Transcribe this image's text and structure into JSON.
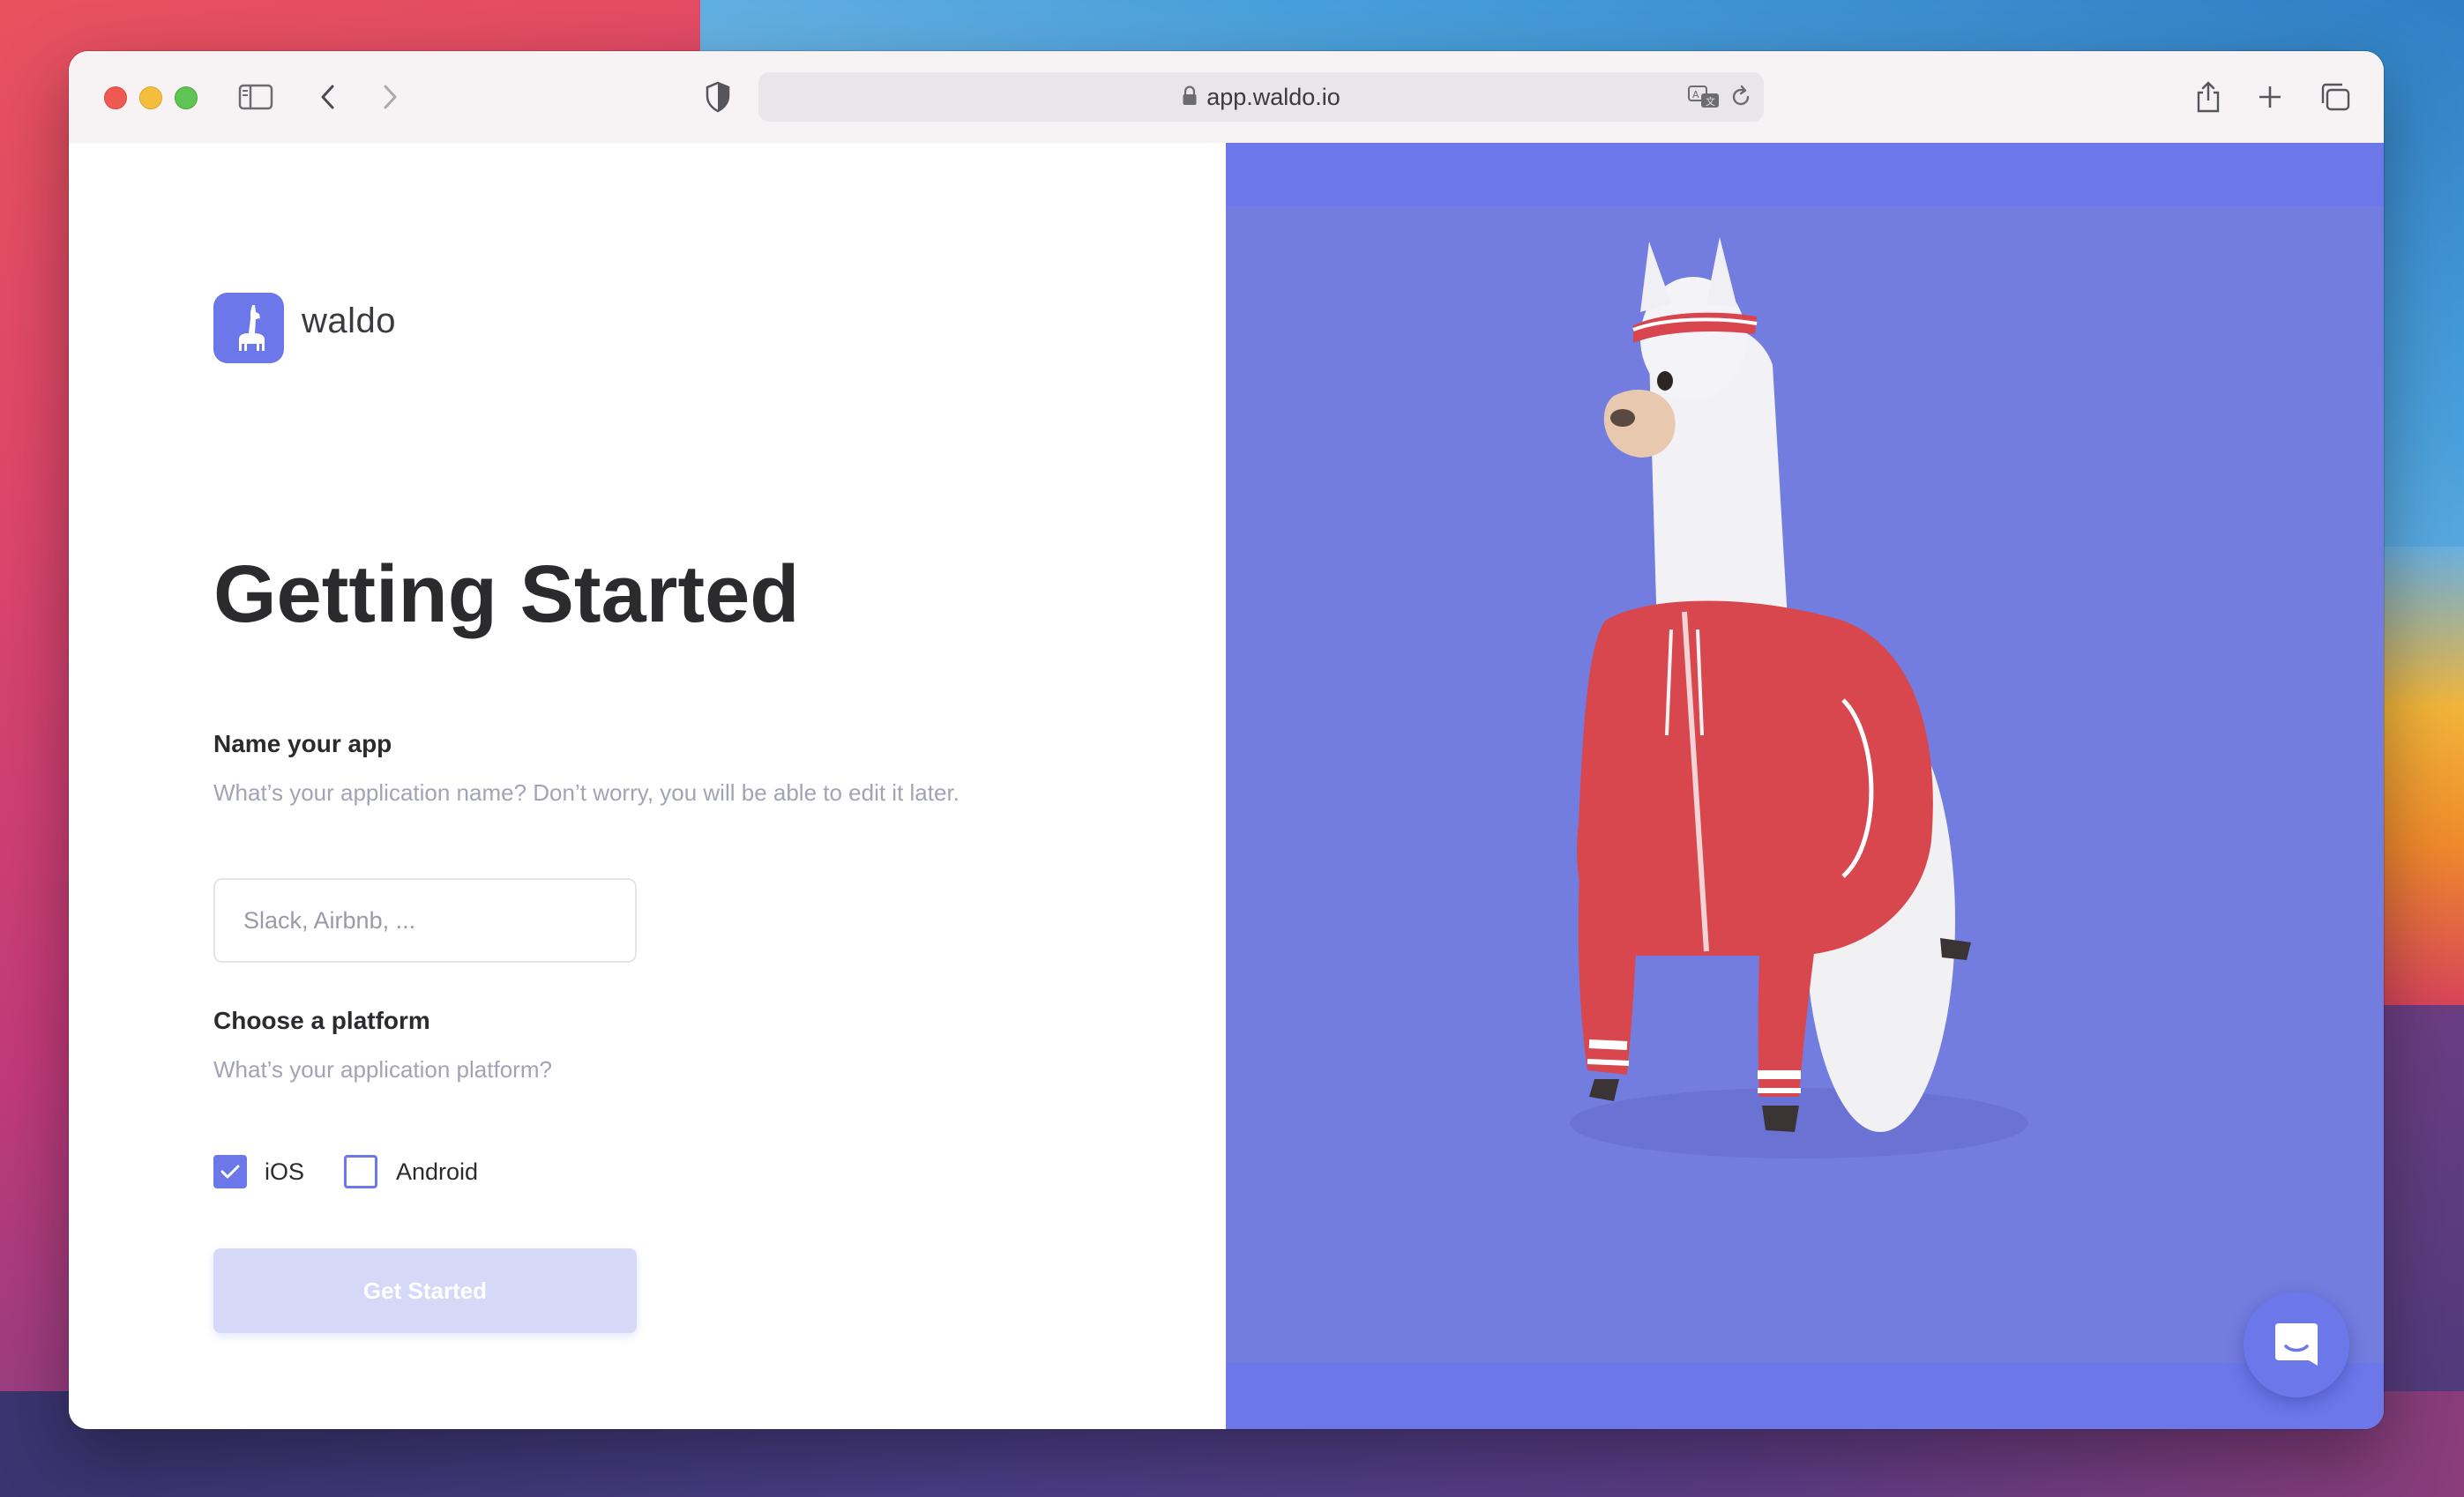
{
  "browser": {
    "url": "app.waldo.io"
  },
  "brand": {
    "name": "waldo",
    "accent_color": "#6c77ea"
  },
  "main": {
    "title": "Getting Started",
    "name_section": {
      "label": "Name your app",
      "hint": "What’s your application name? Don’t worry, you will be able to edit it later.",
      "input_value": "",
      "input_placeholder": "Slack, Airbnb, ..."
    },
    "platform_section": {
      "label": "Choose a platform",
      "hint": "What’s your application platform?",
      "options": [
        {
          "label": "iOS",
          "checked": true
        },
        {
          "label": "Android",
          "checked": false
        }
      ]
    },
    "cta_label": "Get Started"
  },
  "icons": {
    "sidebar": "sidebar-icon",
    "back": "chevron-left-icon",
    "forward": "chevron-right-icon",
    "privacy": "shield-icon",
    "lock": "lock-icon",
    "translate": "translate-icon",
    "reload": "reload-icon",
    "share": "share-icon",
    "new_tab": "plus-icon",
    "tabs": "tabs-overview-icon",
    "chat": "chat-icon"
  }
}
